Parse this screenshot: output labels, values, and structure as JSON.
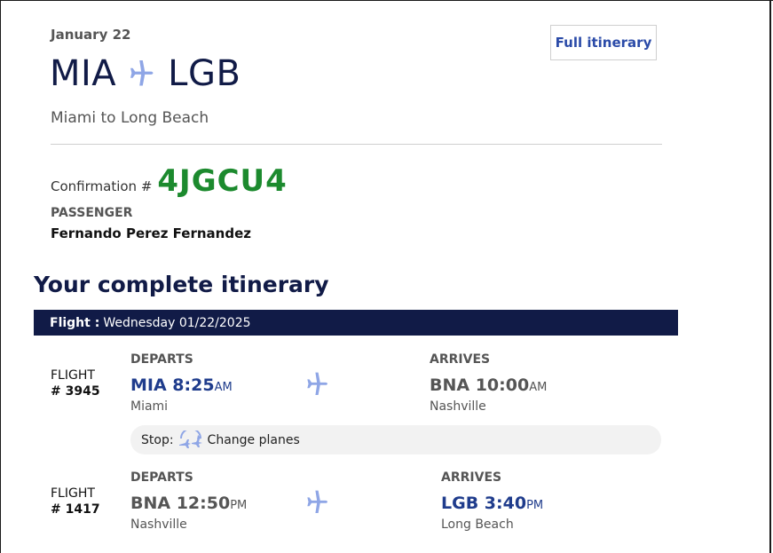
{
  "header": {
    "date": "January 22",
    "origin": "MIA",
    "destination": "LGB",
    "description": "Miami to Long Beach",
    "full_itinerary_button": "Full itinerary"
  },
  "confirmation": {
    "label": "Confirmation #",
    "code": "4JGCU4"
  },
  "passenger": {
    "label": "PASSENGER",
    "name": "Fernando Perez Fernandez"
  },
  "itinerary": {
    "title": "Your complete itinerary",
    "bar_label": "Flight :",
    "bar_date": "Wednesday 01/22/2025",
    "stop_label": "Stop:",
    "stop_text": "Change planes",
    "flights": [
      {
        "flight_label": "FLIGHT",
        "flight_number": "# 3945",
        "depart_label": "DEPARTS",
        "depart_code_time": "MIA 8:25",
        "depart_ampm": "AM",
        "depart_city": "Miami",
        "arrive_label": "ARRIVES",
        "arrive_code_time": "BNA 10:00",
        "arrive_ampm": "AM",
        "arrive_city": "Nashville"
      },
      {
        "flight_label": "FLIGHT",
        "flight_number": "# 1417",
        "depart_label": "DEPARTS",
        "depart_code_time": "BNA 12:50",
        "depart_ampm": "PM",
        "depart_city": "Nashville",
        "arrive_label": "ARRIVES",
        "arrive_code_time": "LGB 3:40",
        "arrive_ampm": "PM",
        "arrive_city": "Long Beach"
      }
    ]
  },
  "icons": {
    "plane": "airplane-icon",
    "change_planes": "change-planes-icon"
  },
  "colors": {
    "navy": "#111b47",
    "link_blue": "#2b4ba8",
    "confirmation_green": "#1c8a2e",
    "plane_icon": "#8fa6e6"
  }
}
